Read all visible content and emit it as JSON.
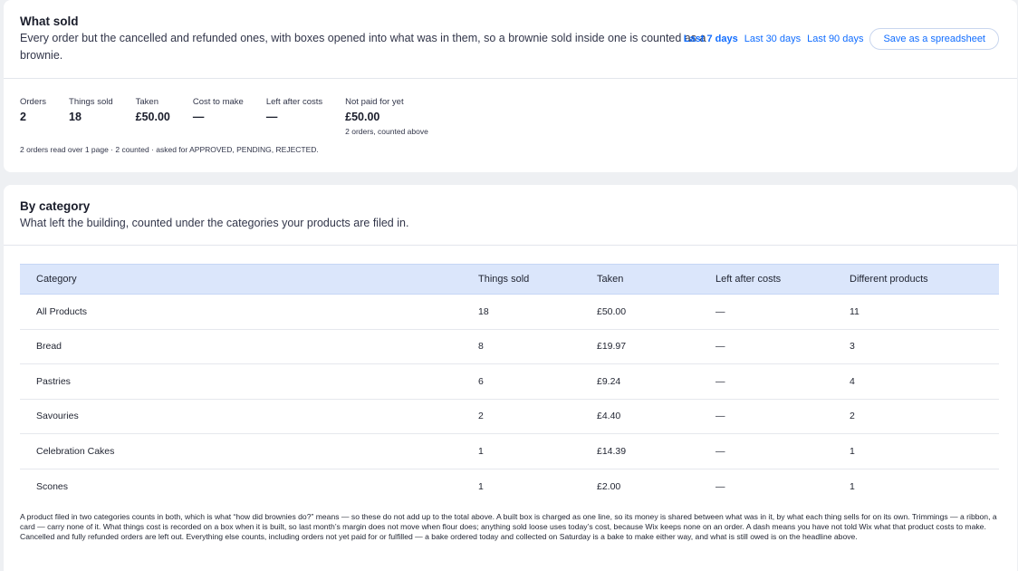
{
  "what_sold": {
    "title": "What sold",
    "subtitle": "Every order but the cancelled and refunded ones, with boxes opened into what was in them, so a brownie sold inside one is counted as a brownie.",
    "ranges": [
      "Last 7 days",
      "Last 30 days",
      "Last 90 days"
    ],
    "active_range": "Last 7 days",
    "spreadsheet_label": "Save as a spreadsheet",
    "stats": [
      {
        "label": "Orders",
        "value": "2",
        "note": ""
      },
      {
        "label": "Things sold",
        "value": "18",
        "note": ""
      },
      {
        "label": "Taken",
        "value": "£50.00",
        "note": ""
      },
      {
        "label": "Cost to make",
        "value": "—",
        "note": ""
      },
      {
        "label": "Left after costs",
        "value": "—",
        "note": ""
      },
      {
        "label": "Not paid for yet",
        "value": "£50.00",
        "note": "2 orders, counted above"
      }
    ],
    "reads_note": "2 orders read over 1 page · 2 counted · asked for APPROVED, PENDING, REJECTED."
  },
  "by_category": {
    "title": "By category",
    "subtitle": "What left the building, counted under the categories your products are filed in.",
    "columns": [
      "Category",
      "Things sold",
      "Taken",
      "Left after costs",
      "Different products"
    ],
    "rows": [
      [
        "All Products",
        "18",
        "£50.00",
        "—",
        "11"
      ],
      [
        "Bread",
        "8",
        "£19.97",
        "—",
        "3"
      ],
      [
        "Pastries",
        "6",
        "£9.24",
        "—",
        "4"
      ],
      [
        "Savouries",
        "2",
        "£4.40",
        "—",
        "2"
      ],
      [
        "Celebration Cakes",
        "1",
        "£14.39",
        "—",
        "1"
      ],
      [
        "Scones",
        "1",
        "£2.00",
        "—",
        "1"
      ]
    ],
    "footnote": "A product filed in two categories counts in both, which is what “how did brownies do?” means — so these do not add up to the total above. A built box is charged as one line, so its money is shared between what was in it, by what each thing sells for on its own. Trimmings — a ribbon, a card — carry none of it. What things cost is recorded on a box when it is built, so last month’s margin does not move when flour does; anything sold loose uses today’s cost, because Wix keeps none on an order. A dash means you have not told Wix what that product costs to make. Cancelled and fully refunded orders are left out. Everything else counts, including orders not yet paid for or fulfilled — a bake ordered today and collected on Saturday is a bake to make either way, and what is still owed is on the headline above."
  },
  "colors": {
    "accent": "#116dff",
    "header_row": "#dbe6fb",
    "page_bg": "#eef0f3"
  }
}
